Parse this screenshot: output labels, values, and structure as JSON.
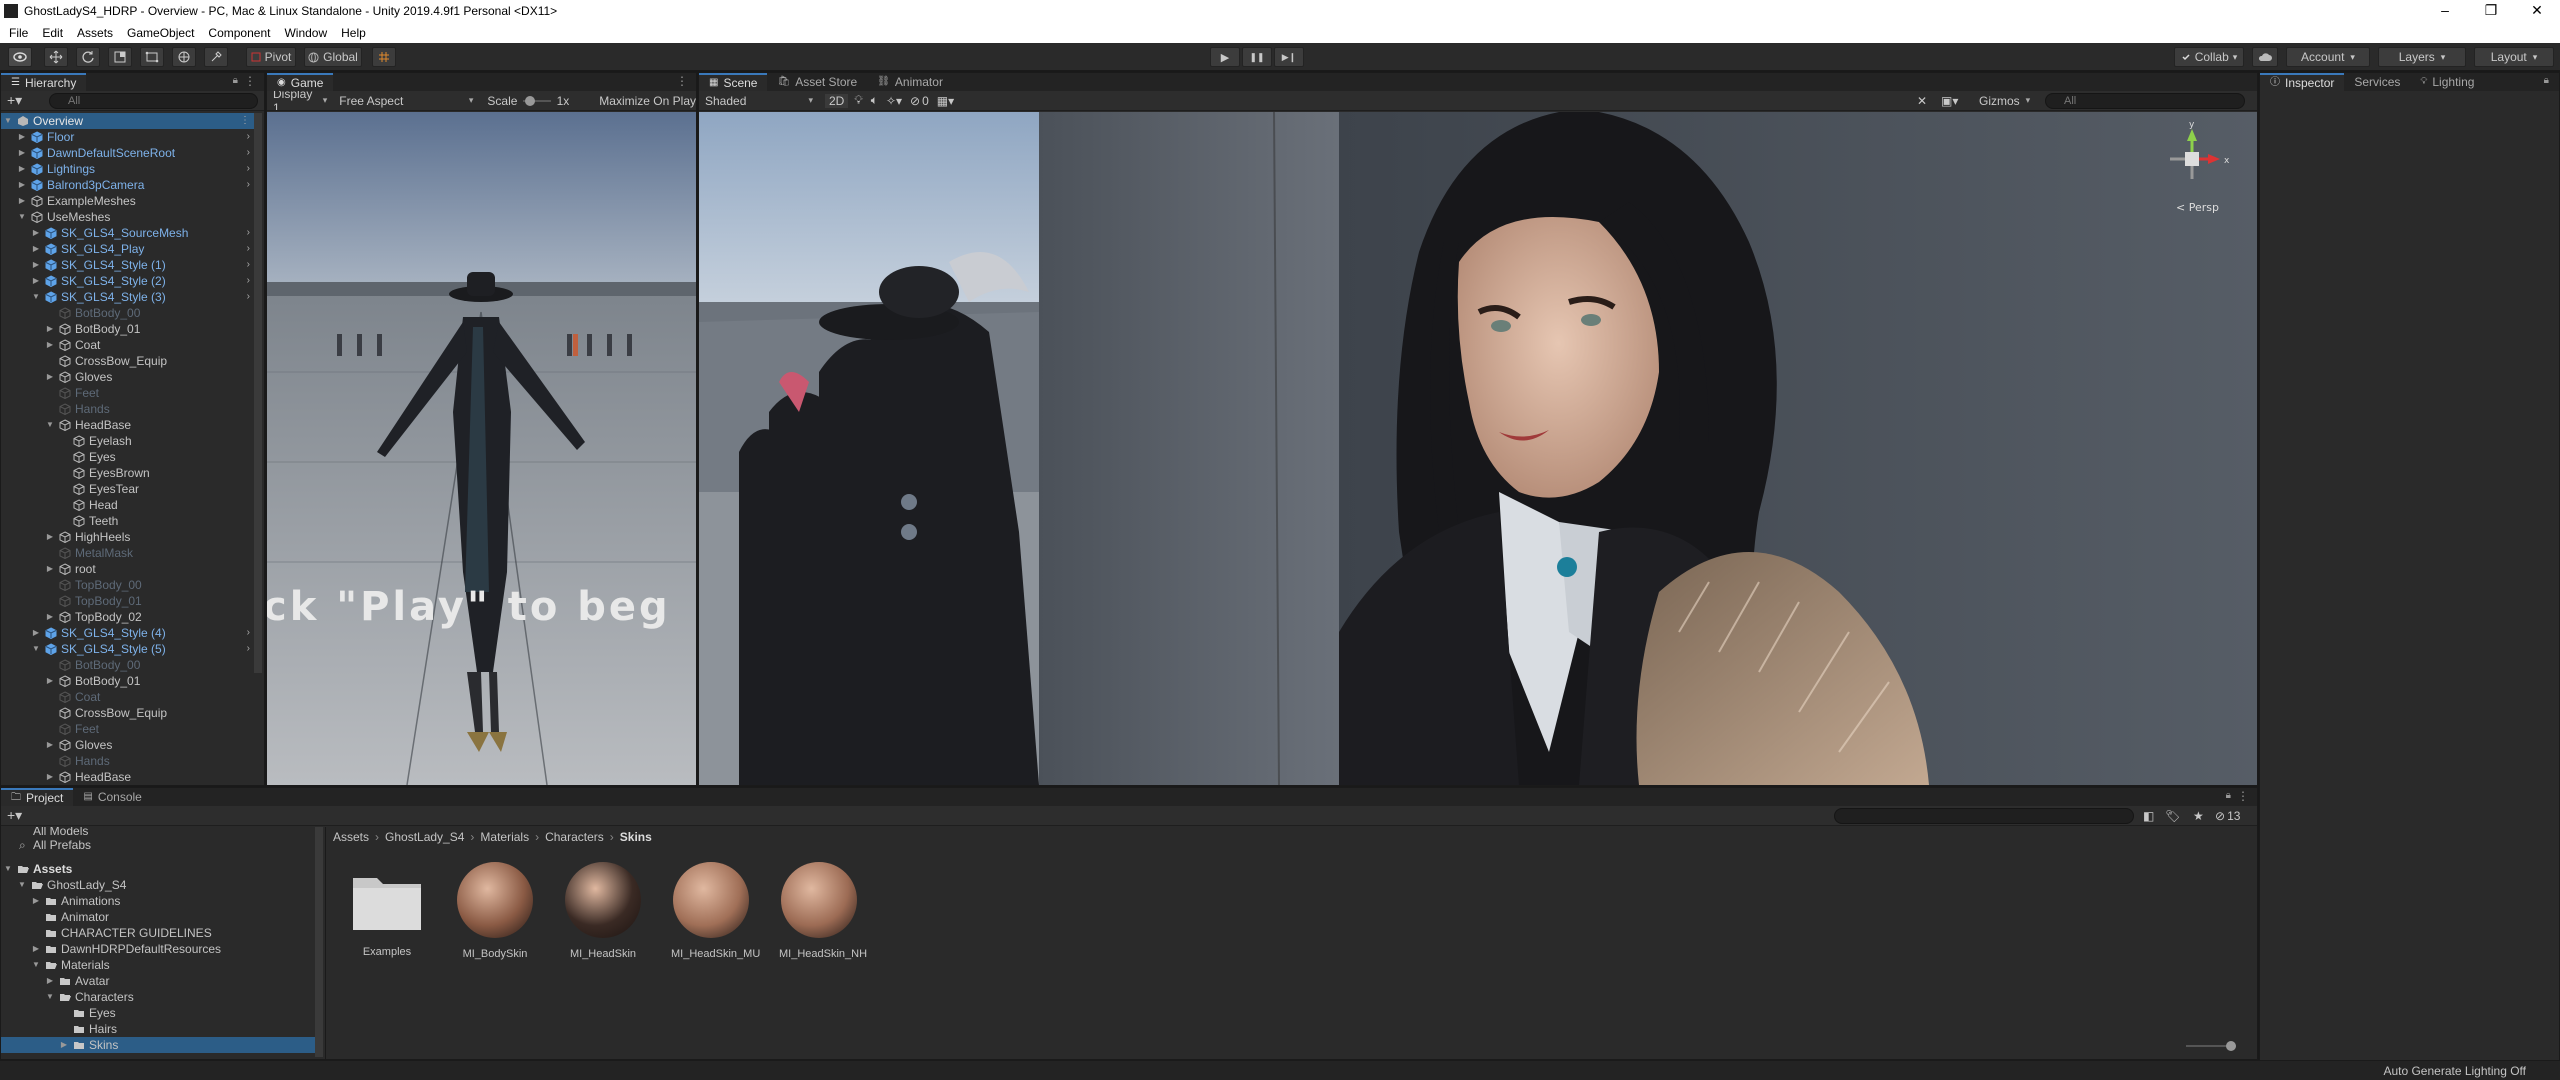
{
  "window": {
    "title": "GhostLadyS4_HDRP - Overview - PC, Mac & Linux Standalone - Unity 2019.4.9f1 Personal <DX11>",
    "minimize": "–",
    "maximize": "❐",
    "close": "✕"
  },
  "menu": [
    "File",
    "Edit",
    "Assets",
    "GameObject",
    "Component",
    "Window",
    "Help"
  ],
  "toolbar": {
    "pivot_label": "Pivot",
    "global_label": "Global",
    "play_glyph": "▶",
    "pause_glyph": "❚❚",
    "step_glyph": "▶❙",
    "collab_label": "Collab",
    "account_label": "Account",
    "layers_label": "Layers",
    "layout_label": "Layout"
  },
  "hierarchy": {
    "tab_label": "Hierarchy",
    "search_placeholder": "All",
    "rows": [
      {
        "label": "Overview",
        "indent": 0,
        "kind": "scene",
        "expanded": true,
        "selected": true
      },
      {
        "label": "Floor",
        "indent": 1,
        "kind": "prefab",
        "collapsed": true,
        "chevron": true
      },
      {
        "label": "DawnDefaultSceneRoot",
        "indent": 1,
        "kind": "prefab",
        "collapsed": true,
        "chevron": true
      },
      {
        "label": "Lightings",
        "indent": 1,
        "kind": "prefab",
        "collapsed": true,
        "chevron": true
      },
      {
        "label": "Balrond3pCamera",
        "indent": 1,
        "kind": "prefab",
        "collapsed": true,
        "chevron": true
      },
      {
        "label": "ExampleMeshes",
        "indent": 1,
        "kind": "normal",
        "collapsed": true
      },
      {
        "label": "UseMeshes",
        "indent": 1,
        "kind": "normal",
        "expanded": true
      },
      {
        "label": "SK_GLS4_SourceMesh",
        "indent": 2,
        "kind": "prefab",
        "collapsed": true,
        "chevron": true
      },
      {
        "label": "SK_GLS4_Play",
        "indent": 2,
        "kind": "prefab",
        "collapsed": true,
        "chevron": true
      },
      {
        "label": "SK_GLS4_Style (1)",
        "indent": 2,
        "kind": "prefab",
        "collapsed": true,
        "chevron": true
      },
      {
        "label": "SK_GLS4_Style (2)",
        "indent": 2,
        "kind": "prefab",
        "collapsed": true,
        "chevron": true
      },
      {
        "label": "SK_GLS4_Style (3)",
        "indent": 2,
        "kind": "prefab",
        "expanded": true,
        "chevron": true
      },
      {
        "label": "BotBody_00",
        "indent": 3,
        "kind": "disabled"
      },
      {
        "label": "BotBody_01",
        "indent": 3,
        "kind": "normal",
        "collapsed": true
      },
      {
        "label": "Coat",
        "indent": 3,
        "kind": "normal",
        "collapsed": true
      },
      {
        "label": "CrossBow_Equip",
        "indent": 3,
        "kind": "normal"
      },
      {
        "label": "Gloves",
        "indent": 3,
        "kind": "normal",
        "collapsed": true
      },
      {
        "label": "Feet",
        "indent": 3,
        "kind": "disabled"
      },
      {
        "label": "Hands",
        "indent": 3,
        "kind": "disabled"
      },
      {
        "label": "HeadBase",
        "indent": 3,
        "kind": "normal",
        "expanded": true
      },
      {
        "label": "Eyelash",
        "indent": 4,
        "kind": "normal"
      },
      {
        "label": "Eyes",
        "indent": 4,
        "kind": "normal"
      },
      {
        "label": "EyesBrown",
        "indent": 4,
        "kind": "normal"
      },
      {
        "label": "EyesTear",
        "indent": 4,
        "kind": "normal"
      },
      {
        "label": "Head",
        "indent": 4,
        "kind": "normal"
      },
      {
        "label": "Teeth",
        "indent": 4,
        "kind": "normal"
      },
      {
        "label": "HighHeels",
        "indent": 3,
        "kind": "normal",
        "collapsed": true
      },
      {
        "label": "MetalMask",
        "indent": 3,
        "kind": "disabled"
      },
      {
        "label": "root",
        "indent": 3,
        "kind": "normal",
        "collapsed": true
      },
      {
        "label": "TopBody_00",
        "indent": 3,
        "kind": "disabled"
      },
      {
        "label": "TopBody_01",
        "indent": 3,
        "kind": "disabled"
      },
      {
        "label": "TopBody_02",
        "indent": 3,
        "kind": "normal",
        "collapsed": true
      },
      {
        "label": "SK_GLS4_Style (4)",
        "indent": 2,
        "kind": "prefab",
        "collapsed": true,
        "chevron": true
      },
      {
        "label": "SK_GLS4_Style (5)",
        "indent": 2,
        "kind": "prefab",
        "expanded": true,
        "chevron": true
      },
      {
        "label": "BotBody_00",
        "indent": 3,
        "kind": "disabled"
      },
      {
        "label": "BotBody_01",
        "indent": 3,
        "kind": "normal",
        "collapsed": true
      },
      {
        "label": "Coat",
        "indent": 3,
        "kind": "disabled"
      },
      {
        "label": "CrossBow_Equip",
        "indent": 3,
        "kind": "normal"
      },
      {
        "label": "Feet",
        "indent": 3,
        "kind": "disabled"
      },
      {
        "label": "Gloves",
        "indent": 3,
        "kind": "normal",
        "collapsed": true
      },
      {
        "label": "Hands",
        "indent": 3,
        "kind": "disabled"
      },
      {
        "label": "HeadBase",
        "indent": 3,
        "kind": "normal",
        "collapsed": true
      }
    ]
  },
  "game": {
    "tab_label": "Game",
    "display_label": "Display 1",
    "aspect_label": "Free Aspect",
    "scale_label": "Scale",
    "scale_value": "1x",
    "maximize_label": "Maximize On Play",
    "overlay_text": "ck \"Play\" to beg"
  },
  "scene": {
    "tabs": [
      "Scene",
      "Asset Store",
      "Animator"
    ],
    "shading_label": "Shaded",
    "mode_2d": "2D",
    "hidden_count": "0",
    "gizmos_label": "Gizmos",
    "search_placeholder": "All",
    "persp_label": "< Persp"
  },
  "inspector": {
    "tabs": [
      "Inspector",
      "Services",
      "Lighting"
    ]
  },
  "project": {
    "tabs": [
      "Project",
      "Console"
    ],
    "hidden_count": "13",
    "favorites": [
      "All Models",
      "All Prefabs"
    ],
    "tree": [
      {
        "label": "Assets",
        "indent": 0,
        "expanded": true,
        "bold": true
      },
      {
        "label": "GhostLady_S4",
        "indent": 1,
        "expanded": true
      },
      {
        "label": "Animations",
        "indent": 2,
        "collapsed": true
      },
      {
        "label": "Animator",
        "indent": 2
      },
      {
        "label": "CHARACTER GUIDELINES",
        "indent": 2
      },
      {
        "label": "DawnHDRPDefaultResources",
        "indent": 2,
        "collapsed": true
      },
      {
        "label": "Materials",
        "indent": 2,
        "expanded": true
      },
      {
        "label": "Avatar",
        "indent": 3,
        "collapsed": true
      },
      {
        "label": "Characters",
        "indent": 3,
        "expanded": true
      },
      {
        "label": "Eyes",
        "indent": 4
      },
      {
        "label": "Hairs",
        "indent": 4
      },
      {
        "label": "Skins",
        "indent": 4,
        "collapsed": true,
        "selected": true
      }
    ],
    "breadcrumb": [
      "Assets",
      "GhostLady_S4",
      "Materials",
      "Characters",
      "Skins"
    ],
    "assets": [
      {
        "label": "Examples",
        "kind": "folder"
      },
      {
        "label": "MI_BodySkin",
        "kind": "material",
        "tone": "#8a5a44"
      },
      {
        "label": "MI_HeadSkin",
        "kind": "material",
        "tone": "#3a2a24"
      },
      {
        "label": "MI_HeadSkin_MU",
        "kind": "material",
        "tone": "#a06f57"
      },
      {
        "label": "MI_HeadSkin_NH",
        "kind": "material",
        "tone": "#9c6b54"
      }
    ]
  },
  "status": {
    "right_text": "Auto Generate Lighting Off"
  },
  "colors": {
    "accent": "#3a79bb",
    "prefab_text": "#7eb2ea",
    "selected_row": "#2c5d87",
    "panel_bg": "#2a2a2a"
  }
}
